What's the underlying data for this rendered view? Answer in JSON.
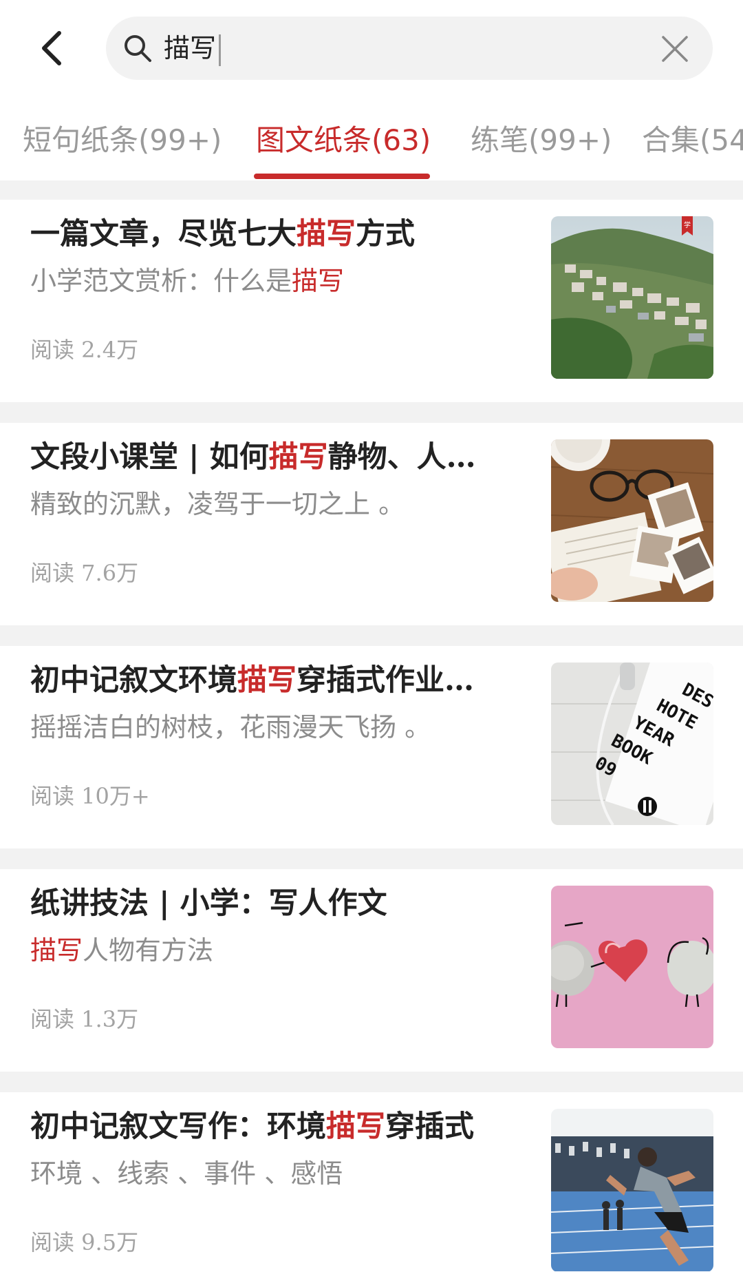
{
  "search": {
    "query": "描写"
  },
  "tabs": [
    {
      "label": "短句纸条(99+)"
    },
    {
      "label": "图文纸条(63)"
    },
    {
      "label": "练笔(99+)"
    },
    {
      "label": "合集(54"
    }
  ],
  "active_tab_index": 1,
  "colors": {
    "accent": "#c82b2b",
    "divider": "#f2f2f2",
    "muted": "#8c8c8c"
  },
  "articles": [
    {
      "title_before": "一篇文章，尽览七大",
      "title_highlight": "描写",
      "title_after": "方式",
      "sub_before": "小学范文赏析：什么是",
      "sub_highlight": "描写",
      "sub_after": "",
      "reads": "阅读 2.4万",
      "thumb_icon": "hillside-town-photo-icon",
      "thumb_badge": "学"
    },
    {
      "title_before": "文段小课堂 | 如何",
      "title_highlight": "描写",
      "title_after": "静物、人…",
      "sub_before": "精致的沉默，凌驾于一切之上 。",
      "sub_highlight": "",
      "sub_after": "",
      "reads": "阅读 7.6万",
      "thumb_icon": "desk-glasses-photos-icon"
    },
    {
      "title_before": "初中记叙文环境",
      "title_highlight": "描写",
      "title_after": "穿插式作业…",
      "sub_before": "摇摇洁白的树枝，花雨漫天飞扬 。",
      "sub_highlight": "",
      "sub_after": "",
      "reads": "阅读 10万+",
      "thumb_icon": "yearbook-earphones-icon",
      "thumb_text": [
        "DES",
        "HOTE",
        "YEAR",
        "BOOK",
        "09"
      ]
    },
    {
      "title_before": "纸讲技法 | 小学：写人作文",
      "title_highlight": "",
      "title_after": "",
      "sub_before": "",
      "sub_highlight": "描写",
      "sub_after": "人物有方法",
      "reads": "阅读 1.3万",
      "thumb_icon": "stones-heart-icon"
    },
    {
      "title_before": "初中记叙文写作：环境",
      "title_highlight": "描写",
      "title_after": "穿插式",
      "sub_before": "环境 、线索 、事件 、感悟",
      "sub_highlight": "",
      "sub_after": "",
      "reads": "阅读 9.5万",
      "thumb_icon": "sprinter-track-icon"
    }
  ]
}
